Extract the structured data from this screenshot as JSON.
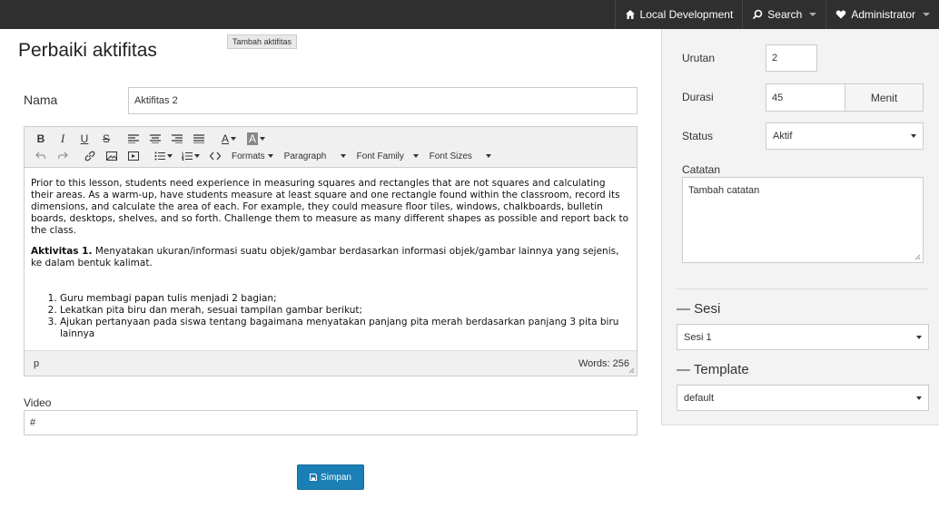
{
  "topbar": {
    "items": [
      {
        "label": "Local Development",
        "icon": "home-icon"
      },
      {
        "label": "Search",
        "icon": "search-icon"
      },
      {
        "label": "Administrator",
        "icon": "heart-icon"
      }
    ]
  },
  "page": {
    "title": "Perbaiki aktifitas",
    "tooltip": "Tambah aktifitas"
  },
  "form": {
    "nama_label": "Nama",
    "nama_value": "Aktifitas 2",
    "video_label": "Video",
    "video_value": "#",
    "save_label": "Simpan"
  },
  "editor": {
    "toolbar": {
      "formats": "Formats",
      "paragraph": "Paragraph",
      "font_family": "Font Family",
      "font_sizes": "Font Sizes"
    },
    "paragraph1": "Prior to this lesson, students need experience in measuring squares and rectangles that are not squares and calculating their areas. As a warm-up, have students measure at least square and one rectangle found within the classroom, record its dimensions, and calculate the area of each. For example, they could measure floor tiles, windows, chalkboards, bulletin boards, desktops, shelves, and so forth. Challenge them to measure as many different shapes as possible and report back to the class.",
    "bold_lead": "Aktivitas 1.",
    "paragraph2": " Menyatakan ukuran/informasi suatu objek/gambar berdasarkan informasi objek/gambar lainnya yang sejenis, ke dalam bentuk kalimat.",
    "list": [
      "Guru membagi papan tulis menjadi 2 bagian;",
      "Lekatkan pita biru dan merah, sesuai tampilan gambar berikut;",
      "Ajukan pertanyaan pada siswa tentang bagaimana menyatakan panjang pita merah berdasarkan panjang 3 pita biru lainnya"
    ],
    "path": "p",
    "word_count": "Words: 256"
  },
  "sidebar": {
    "urutan_label": "Urutan",
    "urutan_value": "2",
    "durasi_label": "Durasi",
    "durasi_value": "45",
    "durasi_unit": "Menit",
    "status_label": "Status",
    "status_value": "Aktif",
    "catatan_label": "Catatan",
    "catatan_value": "Tambah catatan",
    "sesi_title": "— Sesi",
    "sesi_value": "Sesi 1",
    "template_title": "— Template",
    "template_value": "default"
  },
  "colors": {
    "topbar": "#2f2f2f",
    "primary": "#1a7fb5",
    "sidebar_bg": "#f3f3f3"
  }
}
